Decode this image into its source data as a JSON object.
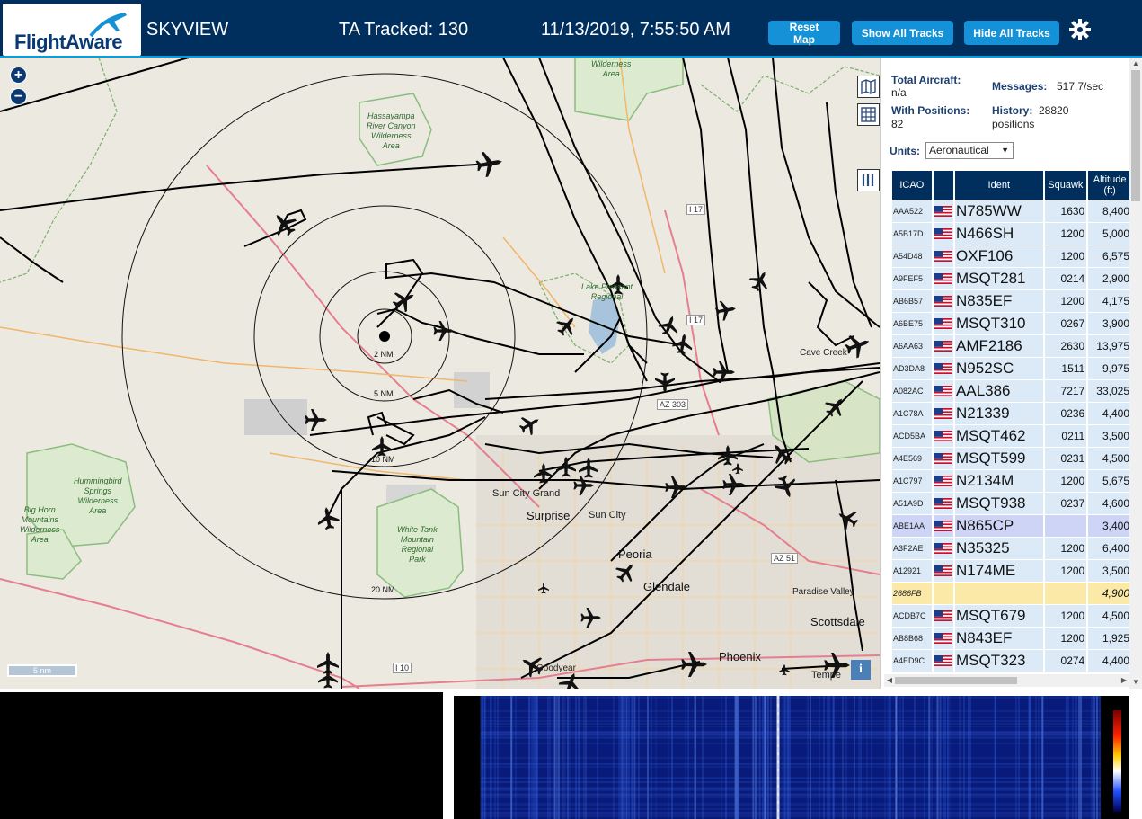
{
  "header": {
    "logo_text": "FlightAware",
    "title": "SKYVIEW",
    "tracked": "TA Tracked: 130",
    "datetime": "11/13/2019, 7:55:50 AM",
    "buttons": {
      "reset": "Reset Map",
      "show": "Show All Tracks",
      "hide": "Hide All Tracks"
    },
    "settings_icon": "gear-icon",
    "brand_color": "#002f5d",
    "button_color": "#1591d7"
  },
  "map": {
    "zoom_in": "+",
    "zoom_out": "−",
    "scale": "5 nm",
    "info": "i",
    "rings": [
      "2 NM",
      "5 NM",
      "10 NM",
      "20 NM"
    ],
    "labels": {
      "wilderness_top": "Wilderness\nArea",
      "hassayampa": "Hassayampa\nRiver Canyon\nWilderness\nArea",
      "hummingbird": "Hummingbird\nSprings\nWilderness\nArea",
      "bighorn": "Big Horn\nMountains\nWilderness\nArea",
      "white_tank": "White Tank\nMountain\nRegional\nPark",
      "lake_pleasant": "Lake Pleasant\nRegional",
      "sun_city_grand": "Sun City Grand",
      "surprise": "Surprise",
      "sun_city": "Sun City",
      "peoria": "Peoria",
      "glendale": "Glendale",
      "paradise_valley": "Paradise Valley",
      "scottsdale": "Scottsdale",
      "phoenix": "Phoenix",
      "goodyear": "Goodyear",
      "tempe": "Tempe",
      "cave_creek": "Cave Creek",
      "i17_a": "I 17",
      "i17_b": "I 17",
      "i10": "I 10",
      "az51": "AZ 51",
      "az303": "AZ 303"
    }
  },
  "stats": {
    "total_label": "Total Aircraft:",
    "total_value": "n/a",
    "messages_label": "Messages:",
    "messages_value": "517.7/sec",
    "positions_label": "With Positions:",
    "positions_value": "82",
    "history_label": "History:",
    "history_value": "28820",
    "history_unit": "positions",
    "units_label": "Units:",
    "units_value": "Aeronautical"
  },
  "table": {
    "headers": {
      "icao": "ICAO",
      "ident": "Ident",
      "squawk": "Squawk",
      "altitude": "Altitude\n(ft)"
    },
    "rows": [
      {
        "icao": "AAA522",
        "ident": "N785WW",
        "squawk": "1630",
        "alt": "8,400"
      },
      {
        "icao": "A5B17D",
        "ident": "N466SH",
        "squawk": "1200",
        "alt": "5,000"
      },
      {
        "icao": "A54D48",
        "ident": "OXF106",
        "squawk": "1200",
        "alt": "6,575"
      },
      {
        "icao": "A9FEF5",
        "ident": "MSQT281",
        "squawk": "0214",
        "alt": "2,900"
      },
      {
        "icao": "AB6B57",
        "ident": "N835EF",
        "squawk": "1200",
        "alt": "4,175"
      },
      {
        "icao": "A6BE75",
        "ident": "MSQT310",
        "squawk": "0267",
        "alt": "3,900"
      },
      {
        "icao": "A6AA63",
        "ident": "AMF2186",
        "squawk": "2630",
        "alt": "13,975"
      },
      {
        "icao": "AD3DA8",
        "ident": "N952SC",
        "squawk": "1511",
        "alt": "9,975"
      },
      {
        "icao": "A082AC",
        "ident": "AAL386",
        "squawk": "7217",
        "alt": "33,025"
      },
      {
        "icao": "A1C78A",
        "ident": "N21339",
        "squawk": "0236",
        "alt": "4,400"
      },
      {
        "icao": "ACD5BA",
        "ident": "MSQT462",
        "squawk": "0211",
        "alt": "3,500"
      },
      {
        "icao": "A4E569",
        "ident": "MSQT599",
        "squawk": "0231",
        "alt": "4,500"
      },
      {
        "icao": "A1C797",
        "ident": "N2134M",
        "squawk": "1200",
        "alt": "5,675"
      },
      {
        "icao": "A51A9D",
        "ident": "MSQT938",
        "squawk": "0237",
        "alt": "4,600"
      },
      {
        "icao": "ABE1AA",
        "ident": "N865CP",
        "squawk": "",
        "alt": "3,400",
        "selected": true
      },
      {
        "icao": "A3F2AE",
        "ident": "N35325",
        "squawk": "1200",
        "alt": "6,400"
      },
      {
        "icao": "A12921",
        "ident": "N174ME",
        "squawk": "1200",
        "alt": "3,500"
      },
      {
        "icao": "2686FB",
        "ident": "",
        "squawk": "",
        "alt": "4,900",
        "no_flag": true
      },
      {
        "icao": "ACDB7C",
        "ident": "MSQT679",
        "squawk": "1200",
        "alt": "4,500"
      },
      {
        "icao": "AB8B68",
        "ident": "N843EF",
        "squawk": "1200",
        "alt": "1,925"
      },
      {
        "icao": "A4ED9C",
        "ident": "MSQT323",
        "squawk": "0274",
        "alt": "4,400"
      }
    ]
  }
}
